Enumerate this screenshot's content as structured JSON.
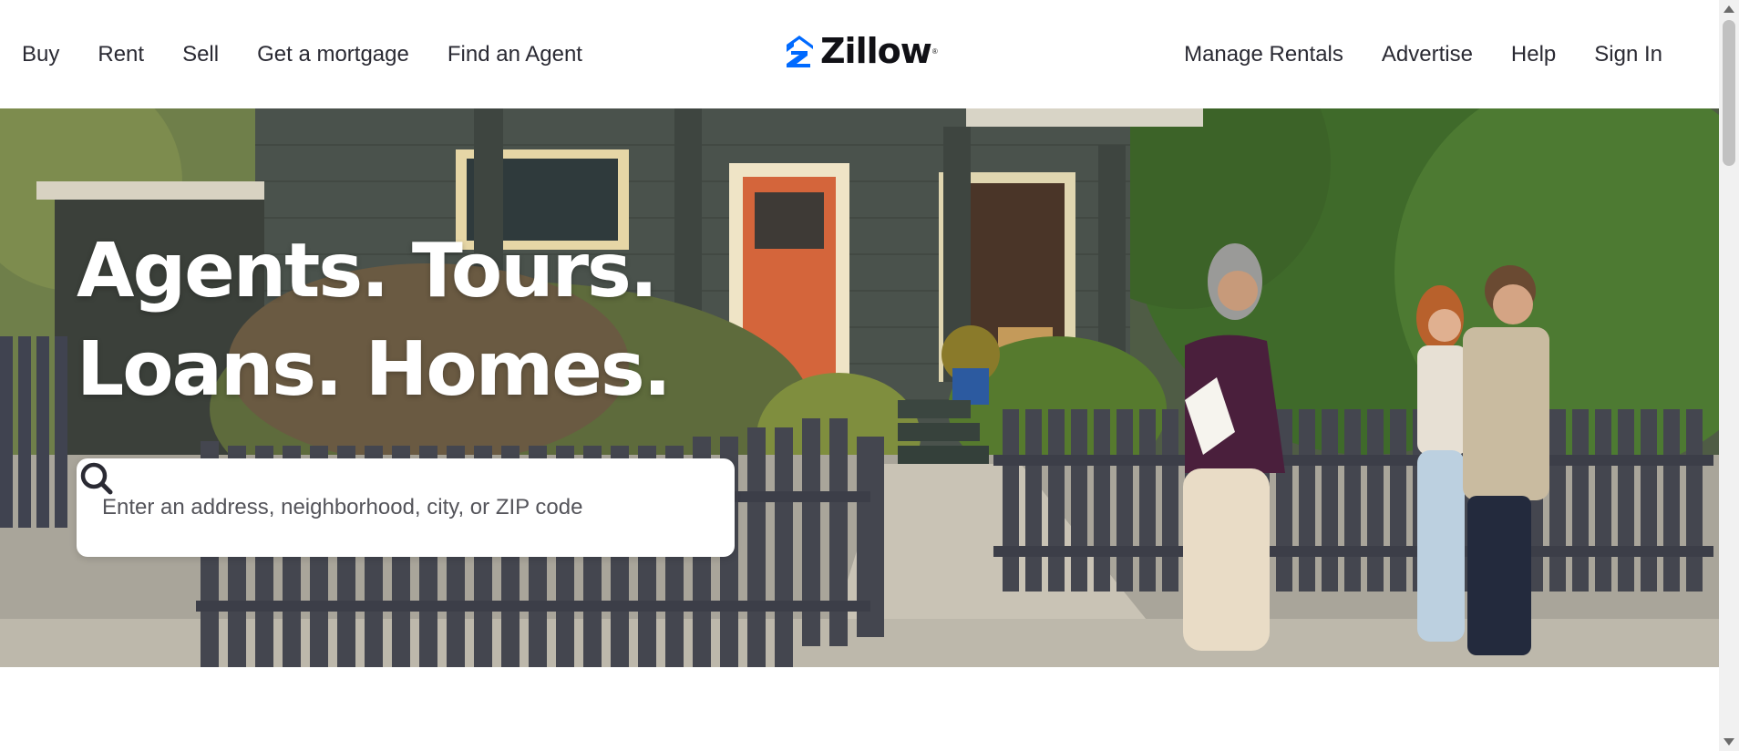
{
  "header": {
    "nav_left": [
      "Buy",
      "Rent",
      "Sell",
      "Get a mortgage",
      "Find an Agent"
    ],
    "nav_right": [
      "Manage Rentals",
      "Advertise",
      "Help",
      "Sign In"
    ],
    "logo_text": "Zillow",
    "logo_registered": "®",
    "brand_color": "#006aff"
  },
  "hero": {
    "headline_line1": "Agents. Tours.",
    "headline_line2": "Loans. Homes.",
    "search_placeholder": "Enter an address, neighborhood, city, or ZIP code",
    "search_icon": "search-icon",
    "image_subject": "house-with-picket-fence-and-people-walking"
  }
}
